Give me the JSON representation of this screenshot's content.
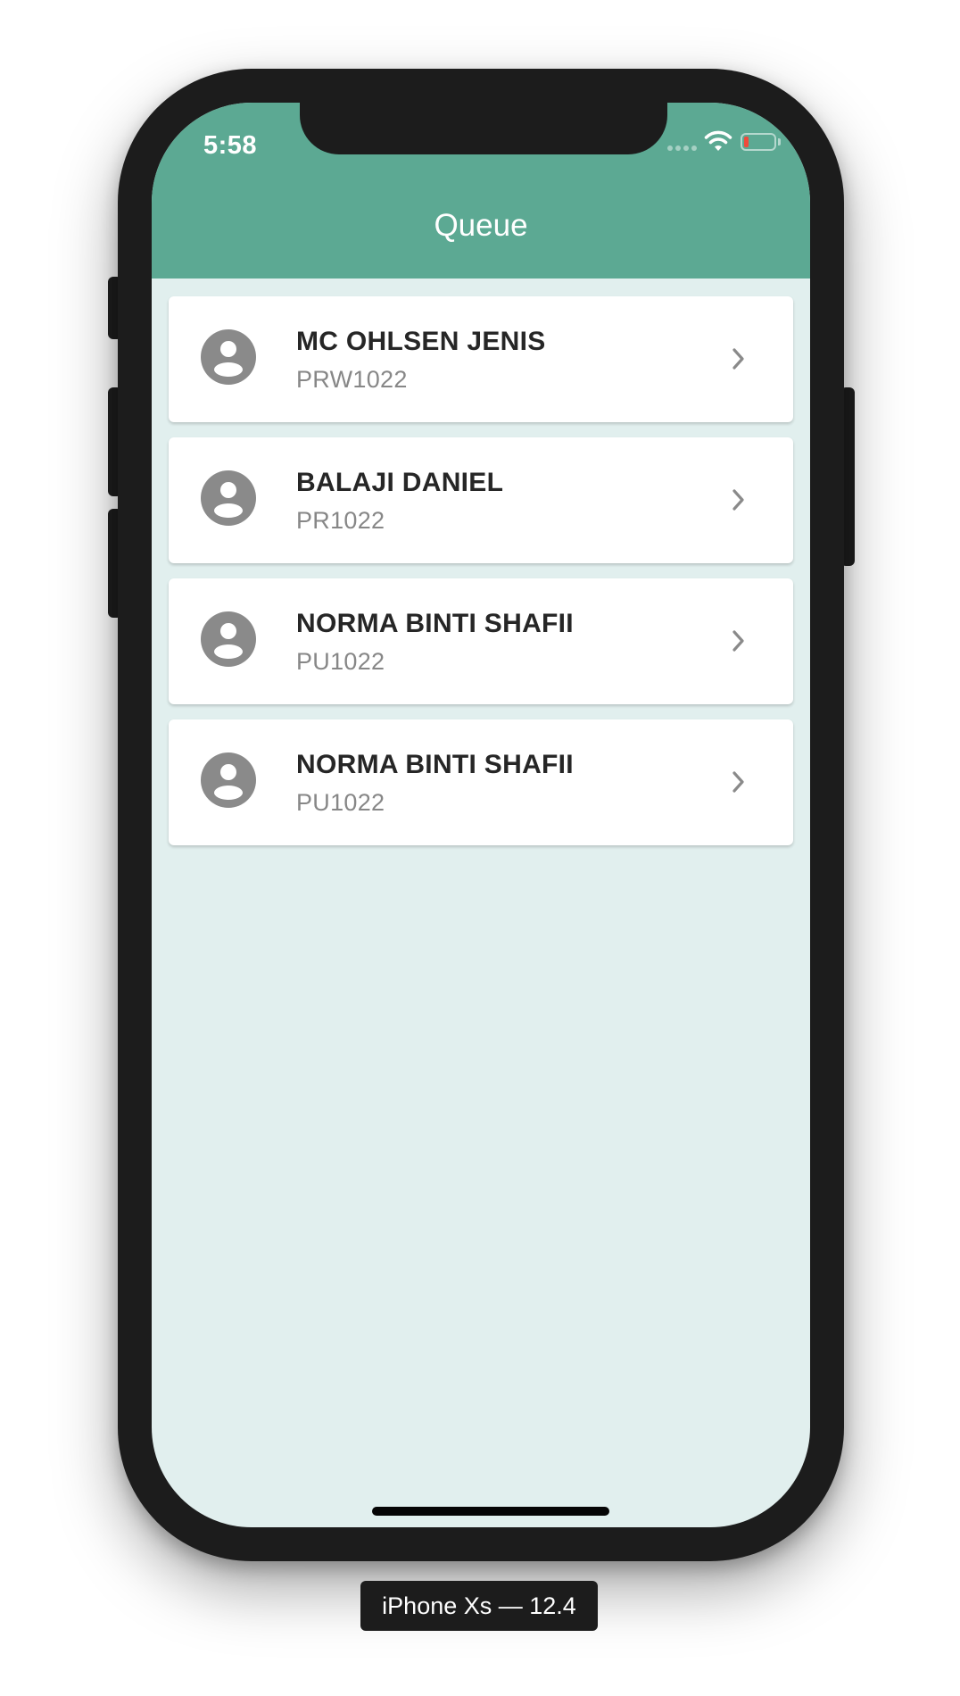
{
  "status_bar": {
    "time": "5:58",
    "icons": [
      "signal-icon",
      "wifi-icon",
      "battery-icon"
    ],
    "battery_color": "#f04a3c"
  },
  "header": {
    "title": "Queue",
    "color": "#5ca993"
  },
  "queue": [
    {
      "name": "MC OHLSEN JENIS",
      "code": "PRW1022",
      "icon": "person-icon"
    },
    {
      "name": "BALAJI DANIEL",
      "code": "PR1022",
      "icon": "person-icon"
    },
    {
      "name": "NORMA BINTI SHAFII",
      "code": "PU1022",
      "icon": "person-icon"
    },
    {
      "name": "NORMA BINTI SHAFII",
      "code": "PU1022",
      "icon": "person-icon"
    }
  ],
  "simulator": {
    "label": "iPhone Xs — 12.4"
  },
  "colors": {
    "background": "#e1efee",
    "card": "#ffffff",
    "icon": "#8a8a8a"
  }
}
